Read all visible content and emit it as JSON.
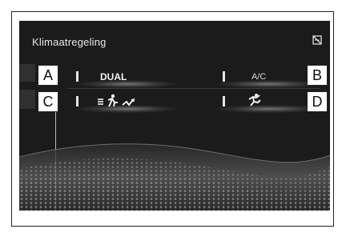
{
  "screen": {
    "title": "Klimaatregeling"
  },
  "buttons": {
    "dual": {
      "label": "DUAL"
    },
    "ac": {
      "label": "A/C"
    }
  },
  "callouts": {
    "a": "A",
    "b": "B",
    "c": "C",
    "d": "D"
  },
  "colors": {
    "screen_bg": "#1b1b1b",
    "text": "#e9e9e9",
    "indicator": "#e6e6e6"
  }
}
